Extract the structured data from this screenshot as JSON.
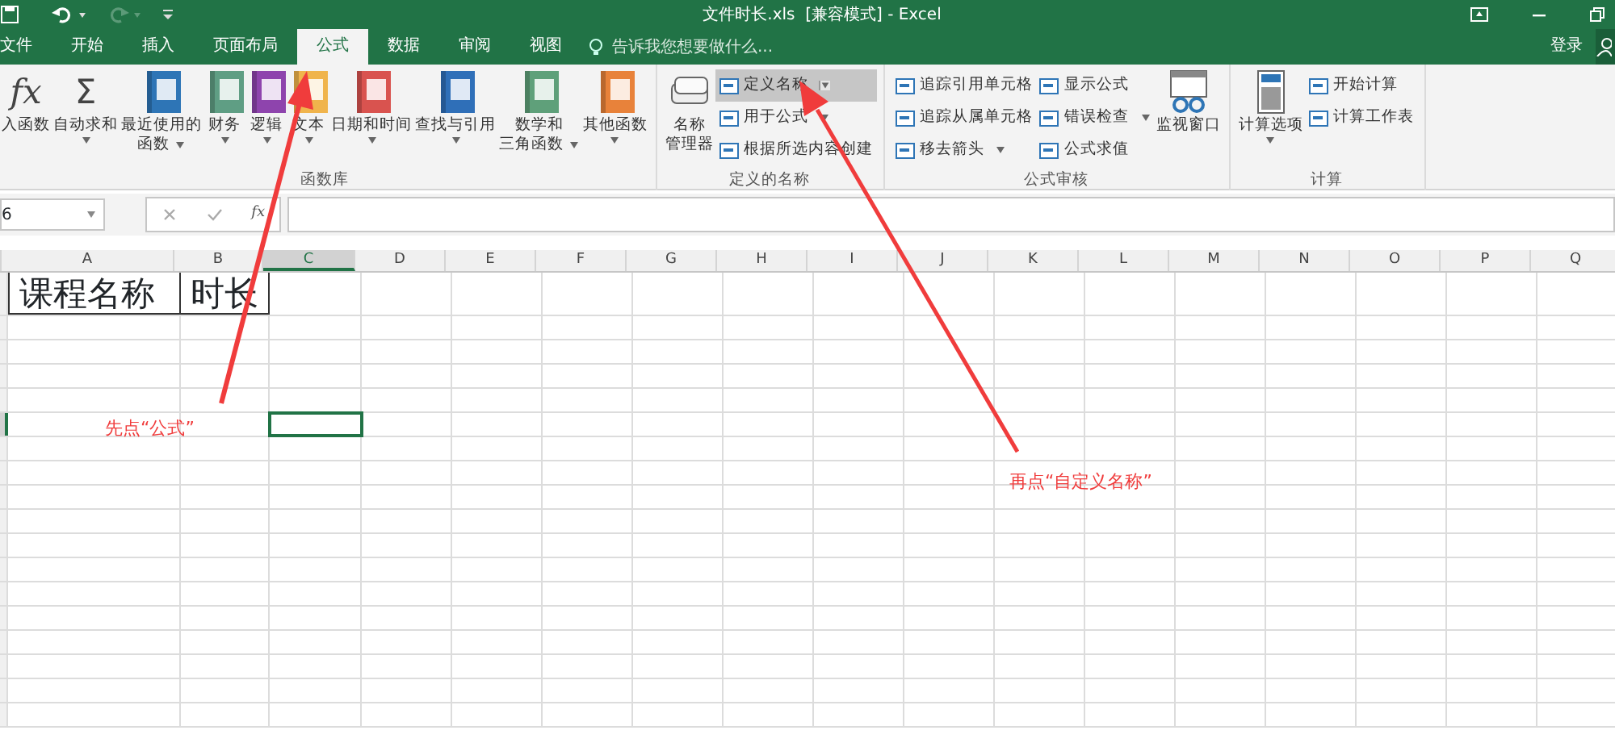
{
  "window": {
    "title": "文件时长.xls  [兼容模式] - Excel"
  },
  "tabs": [
    {
      "label": "文件",
      "selected": false
    },
    {
      "label": "开始",
      "selected": false
    },
    {
      "label": "插入",
      "selected": false
    },
    {
      "label": "页面布局",
      "selected": false
    },
    {
      "label": "公式",
      "selected": true
    },
    {
      "label": "数据",
      "selected": false
    },
    {
      "label": "审阅",
      "selected": false
    },
    {
      "label": "视图",
      "selected": false
    }
  ],
  "tell_me": {
    "placeholder": "告诉我您想要做什么..."
  },
  "sign_in": "登录",
  "ribbon": {
    "groups": [
      {
        "label": "函数库",
        "items": [
          {
            "kind": "large",
            "glyph": "fx",
            "lines": [
              "入函数"
            ],
            "dropdown": false
          },
          {
            "kind": "large",
            "glyph": "Σ",
            "lines": [
              "自动求和"
            ],
            "dropdown": true
          },
          {
            "kind": "large",
            "color": "#2e75b6",
            "lines": [
              "最近使用的",
              "函数"
            ],
            "dropdown": true
          },
          {
            "kind": "large",
            "color": "#5f9e84",
            "lines": [
              "财务"
            ],
            "dropdown": true
          },
          {
            "kind": "large",
            "color": "#8e44ad",
            "lines": [
              "逻辑"
            ],
            "dropdown": true
          },
          {
            "kind": "large",
            "color": "#f0b44c",
            "lines": [
              "文本"
            ],
            "dropdown": true
          },
          {
            "kind": "large",
            "color": "#d9534f",
            "lines": [
              "日期和时间"
            ],
            "dropdown": true
          },
          {
            "kind": "large",
            "color": "#2f6fb8",
            "lines": [
              "查找与引用"
            ],
            "dropdown": true
          },
          {
            "kind": "large",
            "color": "#5fa07a",
            "lines": [
              "数学和",
              "三角函数"
            ],
            "dropdown": true
          },
          {
            "kind": "large",
            "color": "#e8823a",
            "lines": [
              "其他函数"
            ],
            "dropdown": true
          }
        ]
      },
      {
        "label": "定义的名称",
        "items": [
          {
            "kind": "large",
            "lines": [
              "名称",
              "管理器"
            ],
            "dropdown": false
          },
          {
            "kind": "stack",
            "items": [
              {
                "label": "定义名称",
                "dropdown": true,
                "selected": true
              },
              {
                "label": "用于公式",
                "dropdown": true,
                "selected": false
              },
              {
                "label": "根据所选内容创建",
                "dropdown": false,
                "selected": false
              }
            ]
          }
        ]
      },
      {
        "label": "公式审核",
        "items": [
          {
            "kind": "stack",
            "items": [
              {
                "label": "追踪引用单元格",
                "dropdown": false,
                "selected": false
              },
              {
                "label": "追踪从属单元格",
                "dropdown": false,
                "selected": false
              },
              {
                "label": "移去箭头",
                "dropdown": true,
                "selected": false
              }
            ]
          },
          {
            "kind": "stack",
            "items": [
              {
                "label": "显示公式",
                "dropdown": false,
                "selected": false
              },
              {
                "label": "错误检查",
                "dropdown": true,
                "selected": false
              },
              {
                "label": "公式求值",
                "dropdown": false,
                "selected": false
              }
            ]
          },
          {
            "kind": "large",
            "lines": [
              "监视窗口"
            ],
            "dropdown": false
          }
        ]
      },
      {
        "label": "计算",
        "items": [
          {
            "kind": "large",
            "lines": [
              "计算选项"
            ],
            "dropdown": true
          },
          {
            "kind": "stack",
            "items": [
              {
                "label": "开始计算",
                "dropdown": false,
                "selected": false
              },
              {
                "label": "计算工作表",
                "dropdown": false,
                "selected": false
              }
            ]
          }
        ]
      }
    ]
  },
  "formula_bar": {
    "name_box": "6",
    "function_label": "fx"
  },
  "sheet": {
    "columns": [
      {
        "label": "A",
        "selected": false
      },
      {
        "label": "B",
        "selected": false
      },
      {
        "label": "C",
        "selected": true
      },
      {
        "label": "D",
        "selected": false
      },
      {
        "label": "E",
        "selected": false
      },
      {
        "label": "F",
        "selected": false
      },
      {
        "label": "G",
        "selected": false
      },
      {
        "label": "H",
        "selected": false
      },
      {
        "label": "I",
        "selected": false
      },
      {
        "label": "J",
        "selected": false
      },
      {
        "label": "K",
        "selected": false
      },
      {
        "label": "L",
        "selected": false
      },
      {
        "label": "M",
        "selected": false
      },
      {
        "label": "N",
        "selected": false
      },
      {
        "label": "O",
        "selected": false
      },
      {
        "label": "P",
        "selected": false
      },
      {
        "label": "Q",
        "selected": false
      }
    ],
    "rows": [
      {
        "cells": [
          "课程名称",
          "时长"
        ],
        "selected": false
      },
      {
        "selected": false
      },
      {
        "selected": false
      },
      {
        "selected": false
      },
      {
        "selected": false
      },
      {
        "selected": true
      },
      {
        "selected": false
      },
      {
        "selected": false
      },
      {
        "selected": false
      },
      {
        "selected": false
      },
      {
        "selected": false
      },
      {
        "selected": false
      },
      {
        "selected": false
      },
      {
        "selected": false
      },
      {
        "selected": false
      },
      {
        "selected": false
      },
      {
        "selected": false
      },
      {
        "selected": false
      }
    ]
  },
  "annotations": [
    {
      "text": "先点“公式”"
    },
    {
      "text": "再点“自定义名称”"
    }
  ]
}
